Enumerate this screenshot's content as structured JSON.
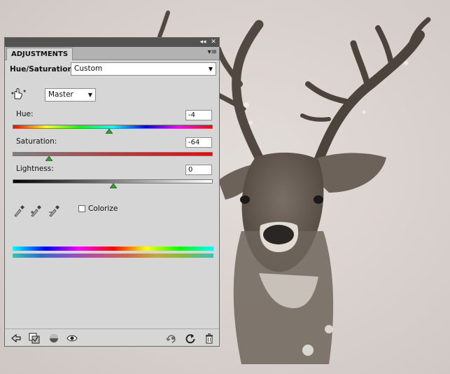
{
  "panel": {
    "tab_label": "ADJUSTMENTS",
    "collapse_glyph": "◂◂",
    "close_glyph": "✕",
    "menu_glyph": "▾≡"
  },
  "header": {
    "adjustment_name": "Hue/Saturation",
    "preset_value": "Custom"
  },
  "channel": {
    "value": "Master"
  },
  "sliders": {
    "hue": {
      "label": "Hue:",
      "value": "-4"
    },
    "saturation": {
      "label": "Saturation:",
      "value": "-64"
    },
    "lightness": {
      "label": "Lightness:",
      "value": "0"
    }
  },
  "options": {
    "colorize_label": "Colorize",
    "colorize_checked": false
  },
  "icons": {
    "on_image_tool": "hand-finger-icon",
    "eyedropper": "eyedropper-icon",
    "eyedropper_add": "eyedropper-plus-icon",
    "eyedropper_subtract": "eyedropper-minus-icon",
    "back": "back-arrow-icon",
    "clip": "clip-to-layer-icon",
    "visibility": "eye-icon",
    "reset": "reset-icon",
    "delete": "trash-icon"
  },
  "colors": {
    "panel_bg": "#d6d6d6",
    "titlebar_bg": "#525252",
    "thumb_green": "#2e8b2e"
  }
}
